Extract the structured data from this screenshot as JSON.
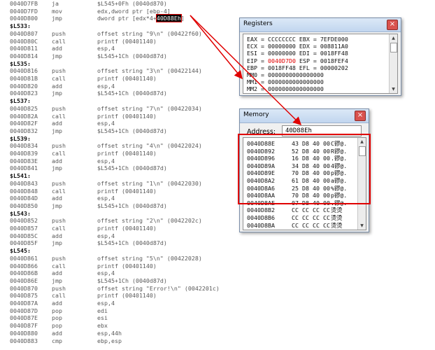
{
  "disassembly": [
    {
      "type": "ins",
      "addr": "0040D7FB",
      "mn": "ja",
      "op": "$L545+0Fh (0040d870)"
    },
    {
      "type": "ins",
      "addr": "0040D7FD",
      "mn": "mov",
      "op": "edx,dword ptr [ebp-4]"
    },
    {
      "type": "ins",
      "addr": "0040D800",
      "mn": "jmp",
      "op": "dword ptr [edx*4+",
      "hl": "40D88Eh",
      "tail": "]"
    },
    {
      "type": "label",
      "text": "$L533:"
    },
    {
      "type": "ins",
      "addr": "0040D807",
      "mn": "push",
      "op": "offset string \"9\\n\" (00422f60)"
    },
    {
      "type": "ins",
      "addr": "0040D80C",
      "mn": "call",
      "op": "printf (00401140)"
    },
    {
      "type": "ins",
      "addr": "0040D811",
      "mn": "add",
      "op": "esp,4"
    },
    {
      "type": "ins",
      "addr": "0040D814",
      "mn": "jmp",
      "op": "$L545+1Ch (0040d87d)"
    },
    {
      "type": "label",
      "text": "$L535:"
    },
    {
      "type": "ins",
      "addr": "0040D816",
      "mn": "push",
      "op": "offset string \"3\\n\" (00422144)"
    },
    {
      "type": "ins",
      "addr": "0040D81B",
      "mn": "call",
      "op": "printf (00401140)"
    },
    {
      "type": "ins",
      "addr": "0040D820",
      "mn": "add",
      "op": "esp,4"
    },
    {
      "type": "ins",
      "addr": "0040D823",
      "mn": "jmp",
      "op": "$L545+1Ch (0040d87d)"
    },
    {
      "type": "label",
      "text": "$L537:"
    },
    {
      "type": "ins",
      "addr": "0040D825",
      "mn": "push",
      "op": "offset string \"7\\n\" (00422034)"
    },
    {
      "type": "ins",
      "addr": "0040D82A",
      "mn": "call",
      "op": "printf (00401140)"
    },
    {
      "type": "ins",
      "addr": "0040D82F",
      "mn": "add",
      "op": "esp,4"
    },
    {
      "type": "ins",
      "addr": "0040D832",
      "mn": "jmp",
      "op": "$L545+1Ch (0040d87d)"
    },
    {
      "type": "label",
      "text": "$L539:"
    },
    {
      "type": "ins",
      "addr": "0040D834",
      "mn": "push",
      "op": "offset string \"4\\n\" (00422024)"
    },
    {
      "type": "ins",
      "addr": "0040D839",
      "mn": "call",
      "op": "printf (00401140)"
    },
    {
      "type": "ins",
      "addr": "0040D83E",
      "mn": "add",
      "op": "esp,4"
    },
    {
      "type": "ins",
      "addr": "0040D841",
      "mn": "jmp",
      "op": "$L545+1Ch (0040d87d)"
    },
    {
      "type": "label",
      "text": "$L541:"
    },
    {
      "type": "ins",
      "addr": "0040D843",
      "mn": "push",
      "op": "offset string \"1\\n\" (00422030)"
    },
    {
      "type": "ins",
      "addr": "0040D848",
      "mn": "call",
      "op": "printf (00401140)"
    },
    {
      "type": "ins",
      "addr": "0040D84D",
      "mn": "add",
      "op": "esp,4"
    },
    {
      "type": "ins",
      "addr": "0040D850",
      "mn": "jmp",
      "op": "$L545+1Ch (0040d87d)"
    },
    {
      "type": "label",
      "text": "$L543:"
    },
    {
      "type": "ins",
      "addr": "0040D852",
      "mn": "push",
      "op": "offset string \"2\\n\" (0042202c)"
    },
    {
      "type": "ins",
      "addr": "0040D857",
      "mn": "call",
      "op": "printf (00401140)"
    },
    {
      "type": "ins",
      "addr": "0040D85C",
      "mn": "add",
      "op": "esp,4"
    },
    {
      "type": "ins",
      "addr": "0040D85F",
      "mn": "jmp",
      "op": "$L545+1Ch (0040d87d)"
    },
    {
      "type": "label",
      "text": "$L545:"
    },
    {
      "type": "ins",
      "addr": "0040D861",
      "mn": "push",
      "op": "offset string \"5\\n\" (00422028)"
    },
    {
      "type": "ins",
      "addr": "0040D866",
      "mn": "call",
      "op": "printf (00401140)"
    },
    {
      "type": "ins",
      "addr": "0040D86B",
      "mn": "add",
      "op": "esp,4"
    },
    {
      "type": "ins",
      "addr": "0040D86E",
      "mn": "jmp",
      "op": "$L545+1Ch (0040d87d)"
    },
    {
      "type": "ins",
      "addr": "0040D870",
      "mn": "push",
      "op": "offset string \"Error!\\n\" (0042201c)"
    },
    {
      "type": "ins",
      "addr": "0040D875",
      "mn": "call",
      "op": "printf (00401140)"
    },
    {
      "type": "ins",
      "addr": "0040D87A",
      "mn": "add",
      "op": "esp,4"
    },
    {
      "type": "ins",
      "addr": "0040D87D",
      "mn": "pop",
      "op": "edi"
    },
    {
      "type": "ins",
      "addr": "0040D87E",
      "mn": "pop",
      "op": "esi"
    },
    {
      "type": "ins",
      "addr": "0040D87F",
      "mn": "pop",
      "op": "ebx"
    },
    {
      "type": "ins",
      "addr": "0040D880",
      "mn": "add",
      "op": "esp,44h"
    },
    {
      "type": "ins",
      "addr": "0040D883",
      "mn": "cmp",
      "op": "ebp,esp"
    }
  ],
  "registers": {
    "title": "Registers",
    "close_glyph": "×",
    "rows": [
      [
        {
          "t": "EAX = CCCCCCCC EBX = 7EFDE000",
          "c": ""
        }
      ],
      [
        {
          "t": "ECX = 00000000 EDX = 008811A0",
          "c": ""
        }
      ],
      [
        {
          "t": "ESI = 00000000 EDI = 0018FF48",
          "c": ""
        }
      ],
      [
        {
          "t": "EIP = ",
          "c": ""
        },
        {
          "t": "0040D7D0",
          "c": "red"
        },
        {
          "t": " ESP = 0018FEF4",
          "c": ""
        }
      ],
      [
        {
          "t": "EBP = 0018FF48 EFL = 00000202",
          "c": ""
        }
      ],
      [
        {
          "t": "MM0 = 0000000000000000",
          "c": ""
        }
      ],
      [
        {
          "t": "MM1 = 0000000000000000",
          "c": ""
        }
      ],
      [
        {
          "t": "MM2 = 0000000000000000",
          "c": ""
        }
      ]
    ]
  },
  "memory": {
    "title": "Memory",
    "close_glyph": "×",
    "address_label": "Address:",
    "address_value": "40D88Eh",
    "rows": [
      {
        "addr": "0040D88E",
        "bytes": "43 D8 40 00",
        "ascii": "C豂@."
      },
      {
        "addr": "0040D892",
        "bytes": "52 D8 40 00",
        "ascii": "R豂@."
      },
      {
        "addr": "0040D896",
        "bytes": "16 D8 40 00",
        "ascii": ".豂@."
      },
      {
        "addr": "0040D89A",
        "bytes": "34 D8 40 00",
        "ascii": "4豂@."
      },
      {
        "addr": "0040D89E",
        "bytes": "70 D8 40 00",
        "ascii": "p豂@."
      },
      {
        "addr": "0040D8A2",
        "bytes": "61 D8 40 00",
        "ascii": "a豂@."
      },
      {
        "addr": "0040D8A6",
        "bytes": "25 D8 40 00",
        "ascii": "%豂@."
      },
      {
        "addr": "0040D8AA",
        "bytes": "70 D8 40 00",
        "ascii": "p豂@."
      },
      {
        "addr": "0040D8AE",
        "bytes": "07 D8 40 00",
        "ascii": ".豂@."
      },
      {
        "addr": "0040D8B2",
        "bytes": "CC CC CC CC",
        "ascii": "烫烫"
      },
      {
        "addr": "0040D8B6",
        "bytes": "CC CC CC CC",
        "ascii": "烫烫"
      },
      {
        "addr": "0040D8BA",
        "bytes": "CC CC CC CC",
        "ascii": "烫烫"
      }
    ]
  },
  "colors": {
    "highlight": "#e00000",
    "eip_value": "#e00000"
  },
  "scroll_glyphs": {
    "up": "▲",
    "down": "▼"
  }
}
